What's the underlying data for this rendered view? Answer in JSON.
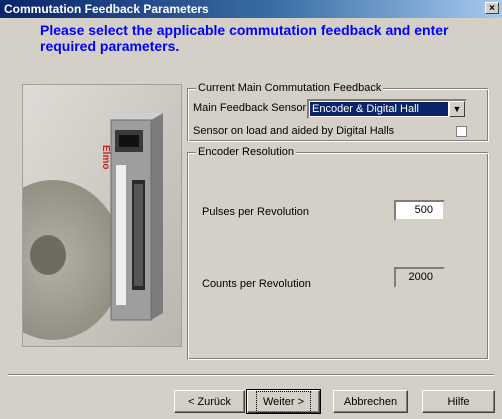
{
  "window": {
    "title": "Commutation Feedback Parameters",
    "close_label": "×"
  },
  "heading": "Please select the applicable commutation feedback and enter required parameters.",
  "device_photo": {
    "brand_text": "Elmo"
  },
  "commutation_group": {
    "legend": "Current Main Commutation Feedback",
    "sensor_label": "Main Feedback Sensor",
    "sensor_value": "Encoder & Digital Hall",
    "load_checkbox_label": "Sensor on load and aided by Digital Halls",
    "load_checkbox_checked": false
  },
  "encoder_group": {
    "legend": "Encoder Resolution",
    "pulses_label": "Pulses per Revolution",
    "pulses_value": "500",
    "counts_label": "Counts per Revolution",
    "counts_value": "2000"
  },
  "buttons": {
    "back": "< Zurück",
    "next": "Weiter >",
    "cancel": "Abbrechen",
    "help": "Hilfe"
  }
}
